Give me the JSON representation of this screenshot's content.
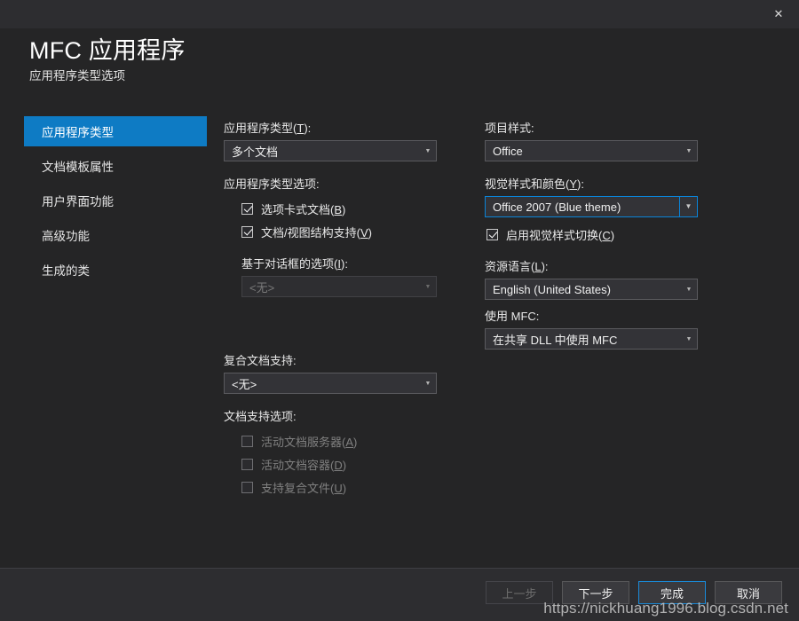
{
  "window": {
    "close_label": "✕"
  },
  "header": {
    "title": "MFC 应用程序",
    "subtitle": "应用程序类型选项"
  },
  "accent_color": "#0e7bc4",
  "focus_color": "#0a84d8",
  "sidebar": {
    "items": [
      {
        "label": "应用程序类型",
        "active": true
      },
      {
        "label": "文档模板属性",
        "active": false
      },
      {
        "label": "用户界面功能",
        "active": false
      },
      {
        "label": "高级功能",
        "active": false
      },
      {
        "label": "生成的类",
        "active": false
      }
    ]
  },
  "middle": {
    "app_type_label": "应用程序类型",
    "app_type_accel": "T",
    "app_type_value": "多个文档",
    "app_type_options_label": "应用程序类型选项:",
    "checkbox_tabbed": "选项卡式文档",
    "checkbox_tabbed_accel": "B",
    "checkbox_docview": "文档/视图结构支持",
    "checkbox_docview_accel": "V",
    "dialog_options_label": "基于对话框的选项",
    "dialog_options_accel": "I",
    "dialog_options_value": "<无>",
    "compound_doc_label": "复合文档支持:",
    "compound_doc_value": "<无>",
    "doc_support_label": "文档支持选项:",
    "checkbox_active_server": "活动文档服务器",
    "checkbox_active_server_accel": "A",
    "checkbox_active_container": "活动文档容器",
    "checkbox_active_container_accel": "D",
    "checkbox_compound_files": "支持复合文件",
    "checkbox_compound_files_accel": "U"
  },
  "right": {
    "project_style_label": "项目样式:",
    "project_style_value": "Office",
    "visual_style_label": "视觉样式和颜色",
    "visual_style_accel": "Y",
    "visual_style_value": "Office 2007 (Blue theme)",
    "checkbox_style_switch": "启用视觉样式切换",
    "checkbox_style_switch_accel": "C",
    "resource_lang_label": "资源语言",
    "resource_lang_accel": "L",
    "resource_lang_value": "English (United States)",
    "use_mfc_label": "使用 MFC:",
    "use_mfc_value": "在共享 DLL 中使用 MFC"
  },
  "footer": {
    "back": "上一步",
    "next": "下一步",
    "finish": "完成",
    "cancel": "取消"
  },
  "watermark": "https://nickhuang1996.blog.csdn.net"
}
